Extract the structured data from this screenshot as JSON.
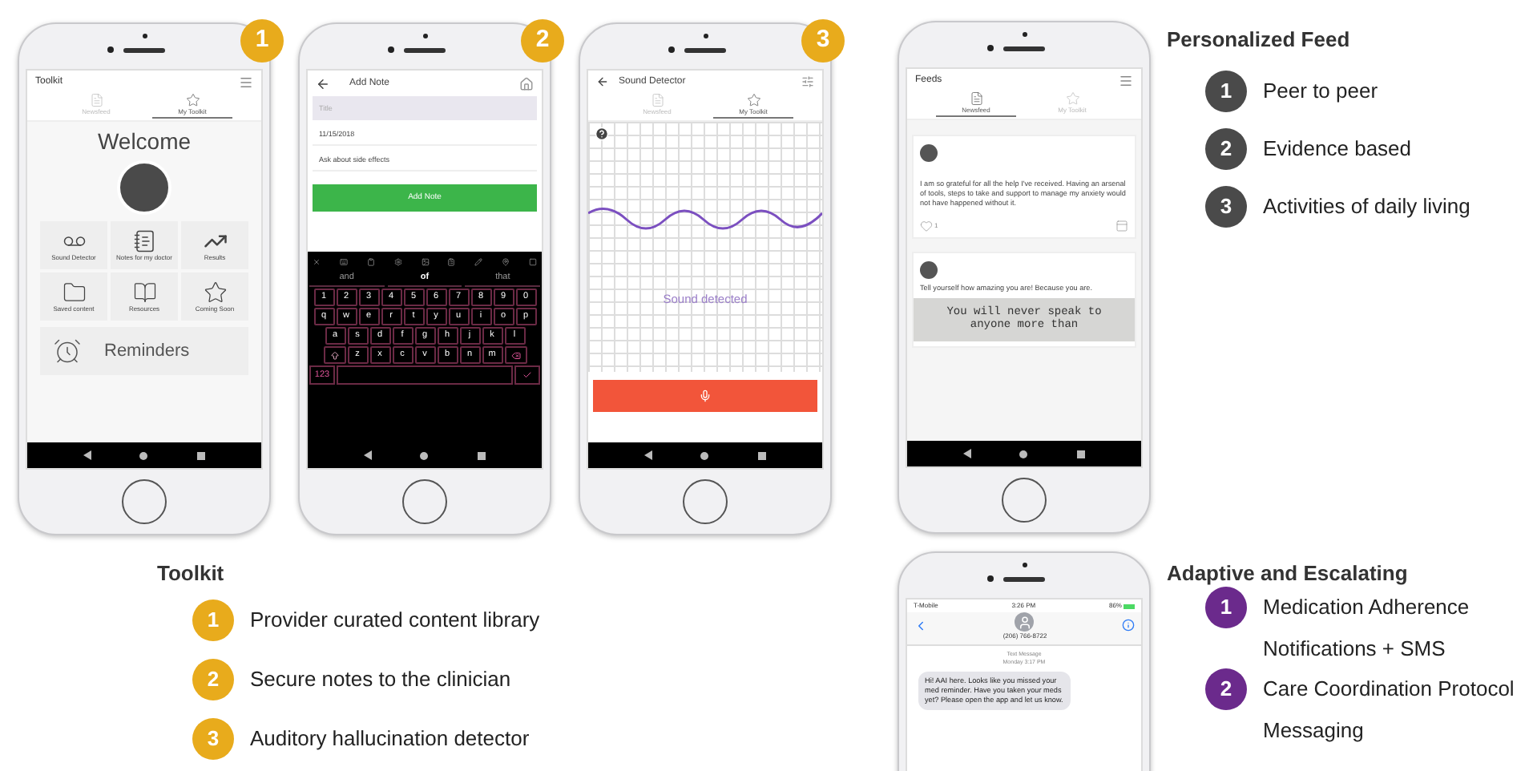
{
  "toolkit_phone": {
    "badge": "1",
    "title": "Toolkit",
    "tabs": [
      {
        "label": "Newsfeed",
        "selected": false
      },
      {
        "label": "My Toolkit",
        "selected": true
      }
    ],
    "heading": "Welcome",
    "tiles": [
      {
        "kind": "voicemail",
        "label": "Sound Detector"
      },
      {
        "kind": "notes",
        "label": "Notes for my doctor"
      },
      {
        "kind": "trend",
        "label": "Results"
      },
      {
        "kind": "folder",
        "label": "Saved content"
      },
      {
        "kind": "book",
        "label": "Resources"
      },
      {
        "kind": "star",
        "label": "Coming Soon"
      }
    ],
    "reminders": "Reminders"
  },
  "note_phone": {
    "badge": "2",
    "title": "Add Note",
    "fields": [
      {
        "placeholder": "Title"
      },
      {
        "value": "11/15/2018"
      },
      {
        "value": "Ask about side effects"
      }
    ],
    "button": "Add Note",
    "suggestions": [
      {
        "label": "and",
        "selected": false
      },
      {
        "label": "of",
        "selected": true
      },
      {
        "label": "that",
        "selected": false
      }
    ],
    "key_rows": [
      [
        "1",
        "2",
        "3",
        "4",
        "5",
        "6",
        "7",
        "8",
        "9",
        "0"
      ],
      [
        "q",
        "w",
        "e",
        "r",
        "t",
        "y",
        "u",
        "i",
        "o",
        "p"
      ],
      [
        "a",
        "s",
        "d",
        "f",
        "g",
        "h",
        "j",
        "k",
        "l"
      ],
      [
        "z",
        "x",
        "c",
        "v",
        "b",
        "n",
        "m"
      ]
    ],
    "mode_key": "123"
  },
  "sound_phone": {
    "badge": "3",
    "title": "Sound Detector",
    "tabs": [
      {
        "label": "Newsfeed",
        "selected": false
      },
      {
        "label": "My Toolkit",
        "selected": true
      }
    ],
    "status": "Sound detected"
  },
  "feed_phone": {
    "title": "Feeds",
    "tabs": [
      {
        "label": "Newsfeed",
        "selected": true
      },
      {
        "label": "My Toolkit",
        "selected": false
      }
    ],
    "posts": [
      {
        "text": "I am so grateful for all the help I've received. Having an arsenal of tools, steps to take and support to manage my anxiety would not have happened without it.",
        "likes": "1"
      },
      {
        "text": "Tell yourself how amazing you are! Because you are.",
        "quote": "You will never speak to anyone more than"
      }
    ]
  },
  "sms_phone": {
    "carrier": "T-Mobile",
    "time": "3:26 PM",
    "battery": "86%",
    "contact": "(206) 766-8722",
    "thread_label": "Text Message",
    "thread_time": "Monday 3:17 PM",
    "message": "Hi! AAI here. Looks like you missed your med reminder. Have you taken your meds yet? Please open the app and let us know."
  },
  "toolkit_legend": {
    "title": "Toolkit",
    "items": [
      {
        "number": "1",
        "lines": [
          "Provider curated content library"
        ]
      },
      {
        "number": "2",
        "lines": [
          "Secure notes to the clinician"
        ]
      },
      {
        "number": "3",
        "lines": [
          "Auditory hallucination detector"
        ]
      }
    ]
  },
  "feed_legend": {
    "title": "Personalized Feed",
    "items": [
      {
        "number": "1",
        "lines": [
          "Peer to peer"
        ]
      },
      {
        "number": "2",
        "lines": [
          "Evidence based"
        ]
      },
      {
        "number": "3",
        "lines": [
          "Activities of daily living"
        ]
      }
    ]
  },
  "adaptive_legend": {
    "title": "Adaptive and Escalating",
    "items": [
      {
        "number": "1",
        "lines": [
          "Medication Adherence",
          "Notifications + SMS"
        ]
      },
      {
        "number": "2",
        "lines": [
          "Care Coordination Protocol",
          "Messaging"
        ]
      }
    ]
  }
}
